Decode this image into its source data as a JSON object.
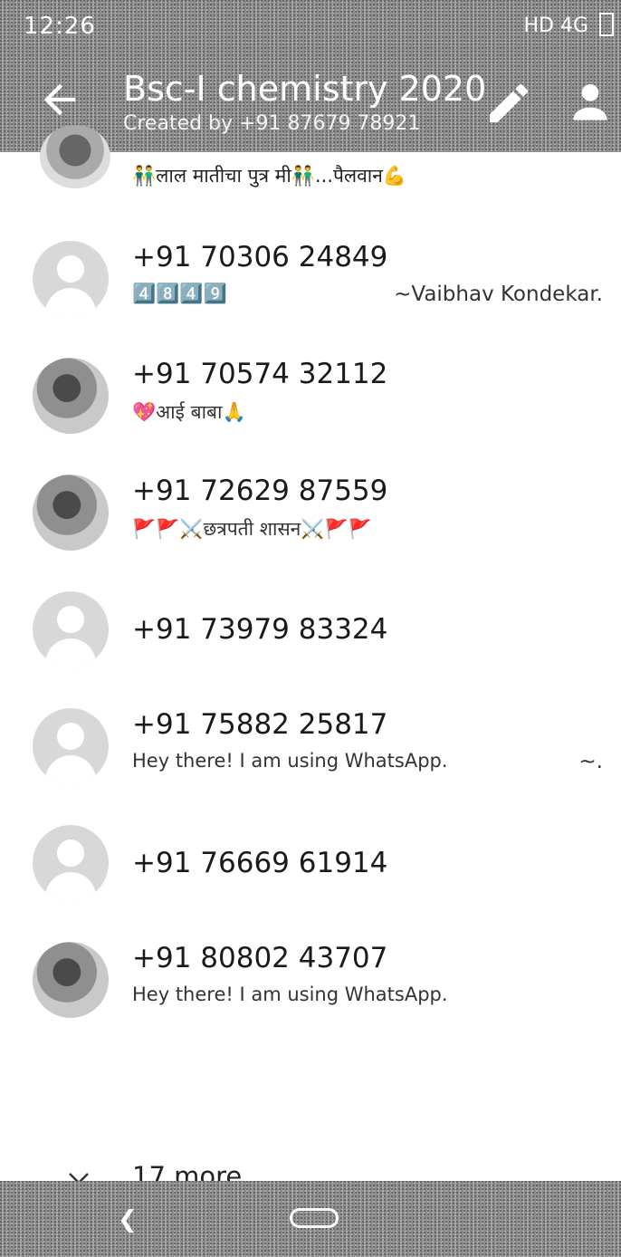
{
  "status_bar": {
    "time": "12:26",
    "right": "HD 4G"
  },
  "app_bar": {
    "title": "Bsc-I chemistry 2020",
    "subtitle": "Created by +91 87679 78921"
  },
  "partial_participant": {
    "status": "👬लाल मातीचा पुत्र मी👬...पैलवान💪"
  },
  "participants": [
    {
      "phone": "+91 70306 24849",
      "about": "4️⃣8️⃣4️⃣9️⃣",
      "push_name": "~Vaibhav Kondekar.",
      "avatar": "default"
    },
    {
      "phone": "+91 70574 32112",
      "about": "💖आई बाबा🙏",
      "push_name": "",
      "avatar": "photo"
    },
    {
      "phone": "+91 72629 87559",
      "about": "🚩🚩⚔️छत्रपती शासन⚔️🚩🚩",
      "push_name": "",
      "avatar": "photo"
    },
    {
      "phone": "+91 73979 83324",
      "about": "",
      "push_name": "",
      "avatar": "default"
    },
    {
      "phone": "+91 75882 25817",
      "about": "Hey there! I am using WhatsApp.",
      "push_name": "~.",
      "avatar": "default"
    },
    {
      "phone": "+91 76669 61914",
      "about": "",
      "push_name": "",
      "avatar": "default"
    },
    {
      "phone": "+91 80802 43707",
      "about": "Hey there! I am using WhatsApp.",
      "push_name": "",
      "avatar": "photo"
    }
  ],
  "more": {
    "label": "17 more"
  }
}
